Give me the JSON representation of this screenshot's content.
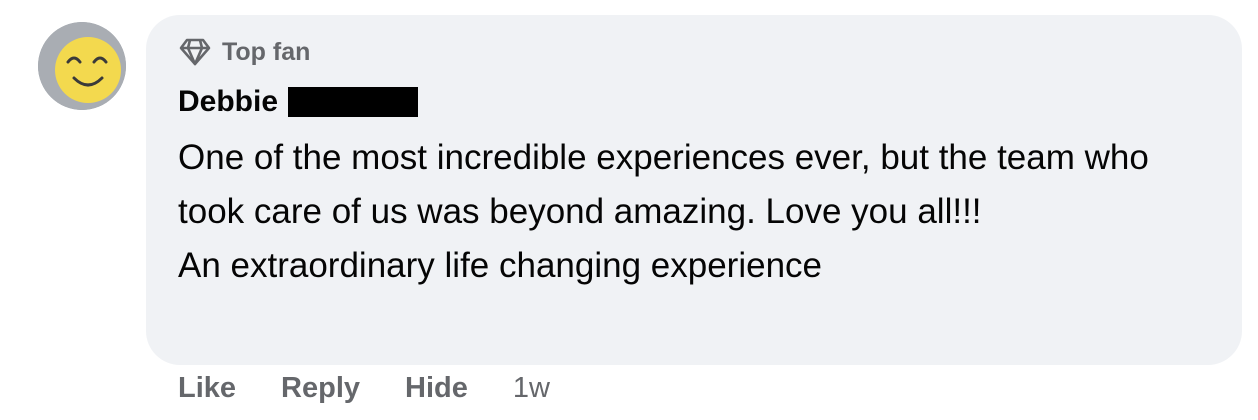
{
  "comment": {
    "badge": {
      "icon": "diamond-icon",
      "label": "Top fan"
    },
    "author": {
      "name": "Debbie",
      "redacted": true
    },
    "paragraphs": [
      "One of the most incredible experiences ever, but the team who took care of us was beyond amazing. Love you all!!!",
      "An extraordinary life changing experience"
    ],
    "actions": {
      "like": "Like",
      "reply": "Reply",
      "hide": "Hide",
      "timestamp": "1w"
    },
    "colors": {
      "bubble": "#f0f2f5",
      "secondary_text": "#65676b",
      "primary_text": "#050505",
      "avatar_face": "#f3d94e"
    }
  }
}
